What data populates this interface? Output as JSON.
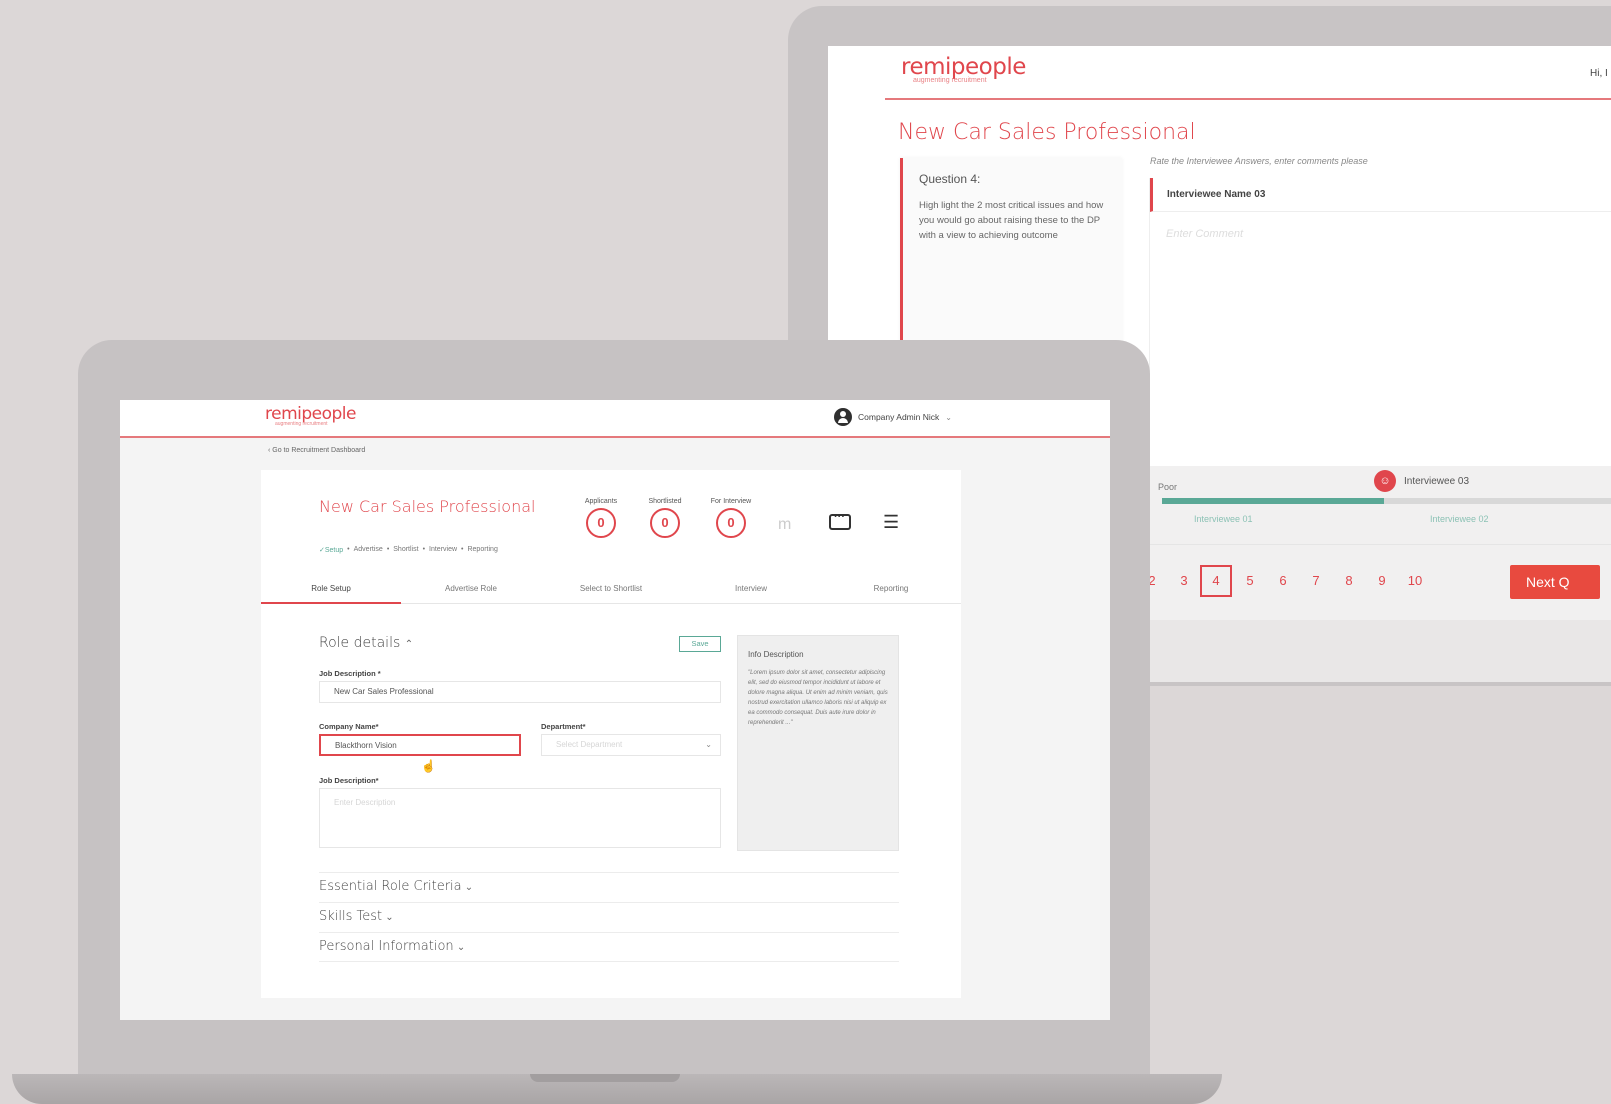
{
  "back_app": {
    "logo": "remipeople",
    "logo_tagline": "augmenting recruitment",
    "greeting": "Hi, I",
    "title": "New Car Sales Professional",
    "question": {
      "label": "Question 4:",
      "text": "High light the 2 most critical issues and how you would go about raising these to the DP with a view to achieving outcome"
    },
    "rate_hint": "Rate the Interviewee Answers, enter comments please",
    "interviewee_name": "Interviewee Name 03",
    "comment_placeholder": "Enter Comment",
    "rating": {
      "low_label": "Poor",
      "current_label": "Interviewee 03",
      "ticks": [
        "Interviewee 01",
        "Interviewee 02"
      ]
    },
    "pagination": {
      "pages": [
        "2",
        "3",
        "4",
        "5",
        "6",
        "7",
        "8",
        "9",
        "10"
      ],
      "current": "4",
      "next_label": "Next Q"
    }
  },
  "front_app": {
    "logo": "remipeople",
    "logo_tagline": "augmenting recruitment",
    "user": "Company Admin Nick",
    "back_link": "Go to Recruitment Dashboard",
    "role_title": "New Car Sales Professional",
    "steps": [
      "✓Setup",
      "Advertise",
      "Shortlist",
      "Interview",
      "Reporting"
    ],
    "stats": [
      {
        "label": "Applicants",
        "value": "0"
      },
      {
        "label": "Shortlisted",
        "value": "0"
      },
      {
        "label": "For Interview",
        "value": "0"
      }
    ],
    "tabs": [
      "Role Setup",
      "Advertise Role",
      "Select to Shortlist",
      "Interview",
      "Reporting"
    ],
    "active_tab": "Role Setup",
    "section_title": "Role details",
    "save_label": "Save",
    "fields": {
      "job_description_label": "Job Description *",
      "job_description_value": "New Car Sales Professional",
      "company_label": "Company Name*",
      "company_value": "Blackthorn Vision",
      "department_label": "Department*",
      "department_placeholder": "Select Department",
      "job_desc2_label": "Job Description*",
      "job_desc2_placeholder": "Enter Description"
    },
    "info": {
      "title": "Info Description",
      "text": "\"Lorem ipsum dolor sit amet, consectetur adipiscing elit, sed do eiusmod tempor incididunt ut labore et dolore magna aliqua. Ut enim ad minim veniam, quis nostrud exercitation ullamco laboris nisi ut aliquip ex ea commodo consequat. Duis aute irure dolor in reprehenderit ...\""
    },
    "accordion": [
      "Essential Role Criteria",
      "Skills Test",
      "Personal Information"
    ]
  },
  "colors": {
    "brand_red": "#e0464c",
    "accent_green": "#5aa896",
    "background": "#dcd7d7"
  }
}
